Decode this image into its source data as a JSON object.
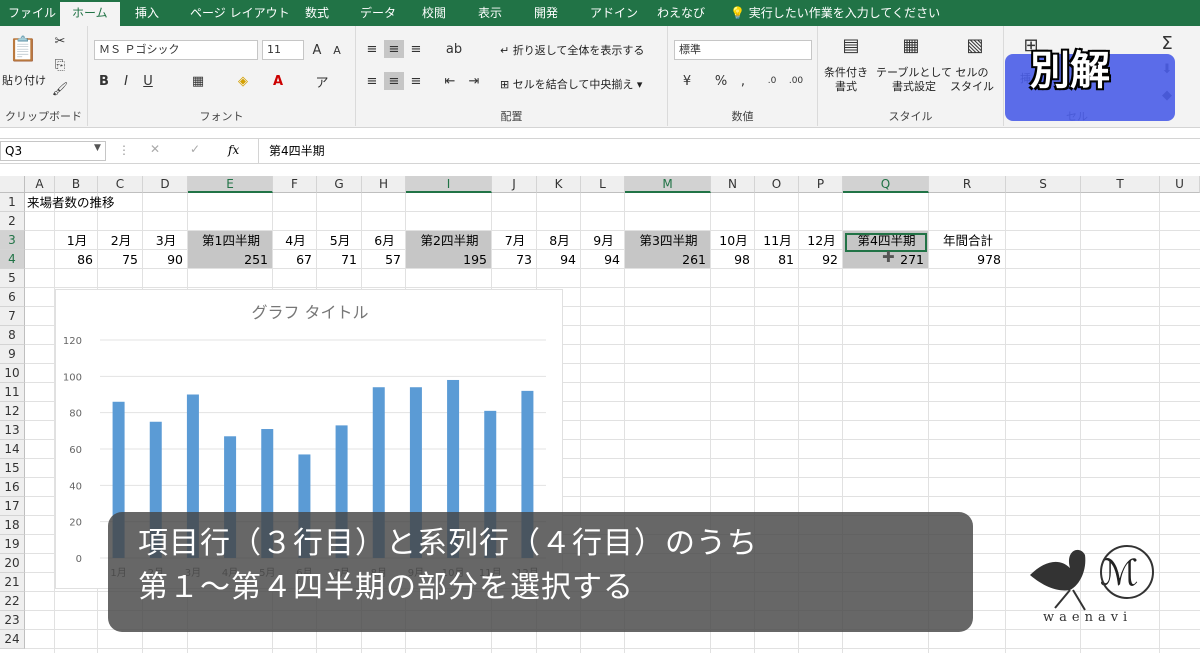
{
  "ribbon_tabs": [
    "ファイル",
    "ホーム",
    "挿入",
    "ページ レイアウト",
    "数式",
    "データ",
    "校閲",
    "表示",
    "開発",
    "アドイン",
    "わえなび"
  ],
  "tell_me": "実行したい作業を入力してください",
  "clipboard": {
    "paste": "貼り付け",
    "group": "クリップボード"
  },
  "font": {
    "name": "ＭＳ Ｐゴシック",
    "size": "11",
    "bold": "B",
    "italic": "I",
    "underline": "U",
    "group": "フォント"
  },
  "alignment": {
    "wrap": "折り返して全体を表示する",
    "merge": "セルを結合して中央揃え",
    "group": "配置"
  },
  "number": {
    "format": "標準",
    "percent": "%",
    "comma": ",",
    "group": "数値"
  },
  "styles": {
    "conditional": "条件付き\n書式",
    "table": "テーブルとして\n書式設定",
    "cell": "セルの\nスタイル",
    "group": "スタイル"
  },
  "cells": {
    "insert": "挿入",
    "group": "セル"
  },
  "overlay_label": "別解",
  "name_box": "Q3",
  "formula_fx": "fx",
  "formula_value": "第4四半期",
  "columns": [
    "A",
    "B",
    "C",
    "D",
    "E",
    "F",
    "G",
    "H",
    "I",
    "J",
    "K",
    "L",
    "M",
    "N",
    "O",
    "P",
    "Q",
    "R",
    "S",
    "T",
    "U"
  ],
  "rows": [
    "1",
    "2",
    "3",
    "4",
    "5",
    "6",
    "7",
    "8",
    "9",
    "10",
    "11",
    "12",
    "13",
    "14",
    "15",
    "16",
    "17",
    "18",
    "19",
    "20",
    "21",
    "22",
    "23",
    "24"
  ],
  "sheet": {
    "title": "来場者数の推移",
    "headers": [
      "1月",
      "2月",
      "3月",
      "第1四半期",
      "4月",
      "5月",
      "6月",
      "第2四半期",
      "7月",
      "8月",
      "9月",
      "第3四半期",
      "10月",
      "11月",
      "12月",
      "第4四半期",
      "年間合計"
    ],
    "values": [
      "86",
      "75",
      "90",
      "251",
      "67",
      "71",
      "57",
      "195",
      "73",
      "94",
      "94",
      "261",
      "98",
      "81",
      "92",
      "271",
      "978"
    ]
  },
  "chart_data": {
    "type": "bar",
    "title": "グラフ タイトル",
    "categories": [
      "1月",
      "2月",
      "3月",
      "4月",
      "5月",
      "6月",
      "7月",
      "8月",
      "9月",
      "10月",
      "11月",
      "12月"
    ],
    "values": [
      86,
      75,
      90,
      67,
      71,
      57,
      73,
      94,
      94,
      98,
      81,
      92
    ],
    "ylim": [
      0,
      120
    ],
    "yticks": [
      "0",
      "20",
      "40",
      "60",
      "80",
      "100",
      "120"
    ],
    "grid": true,
    "color": "#5b9bd5"
  },
  "caption": {
    "line1": "項目行（３行目）と系列行（４行目）のうち",
    "line2": "第１～第４四半期の部分を選択する"
  },
  "logo_text": "waenavi"
}
